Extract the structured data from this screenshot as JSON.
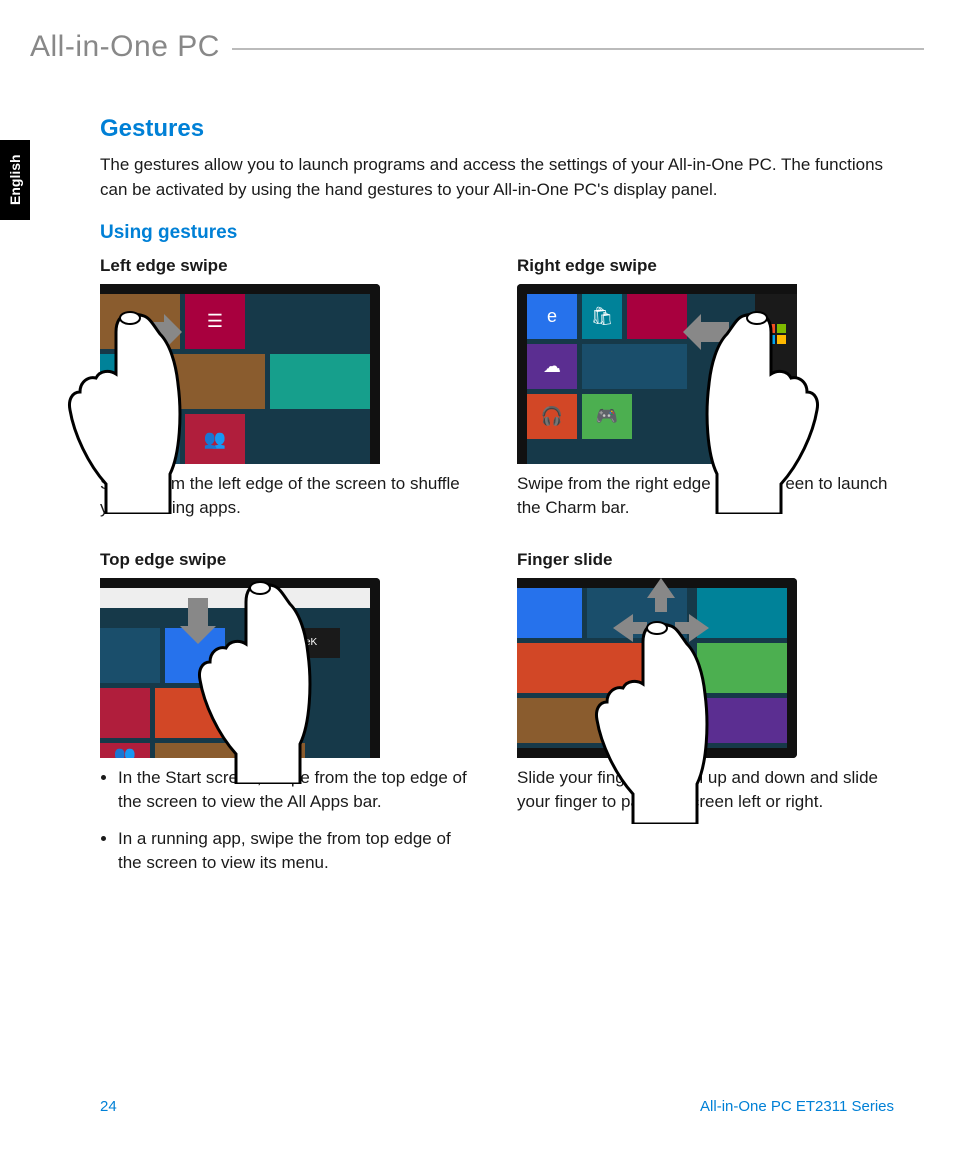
{
  "header": {
    "product_name": "All-in-One PC"
  },
  "lang_tab": "English",
  "section": {
    "title": "Gestures",
    "intro": "The gestures allow you to launch programs and access the settings of your All-in-One PC. The functions can be activated by using the hand gestures to your All-in-One PC's display panel.",
    "subheading": "Using gestures"
  },
  "gestures": {
    "left": {
      "title": "Left edge swipe",
      "desc": "Swipe from the left edge of the screen to shuffle your running apps."
    },
    "right": {
      "title": "Right edge swipe",
      "desc": "Swipe from the right edge of the screen to launch the Charm bar."
    },
    "top": {
      "title": "Top edge swipe",
      "bullets": [
        "In the Start screen, swipe from the top edge of the screen to view the All Apps bar.",
        "In a running app, swipe the from top edge of the screen to view its menu."
      ]
    },
    "slide": {
      "title": "Finger slide",
      "desc": "Slide your finger to scroll up and down and slide your finger to pan the screen left or right."
    }
  },
  "footer": {
    "page": "24",
    "series": "All-in-One PC ET2311 Series"
  }
}
